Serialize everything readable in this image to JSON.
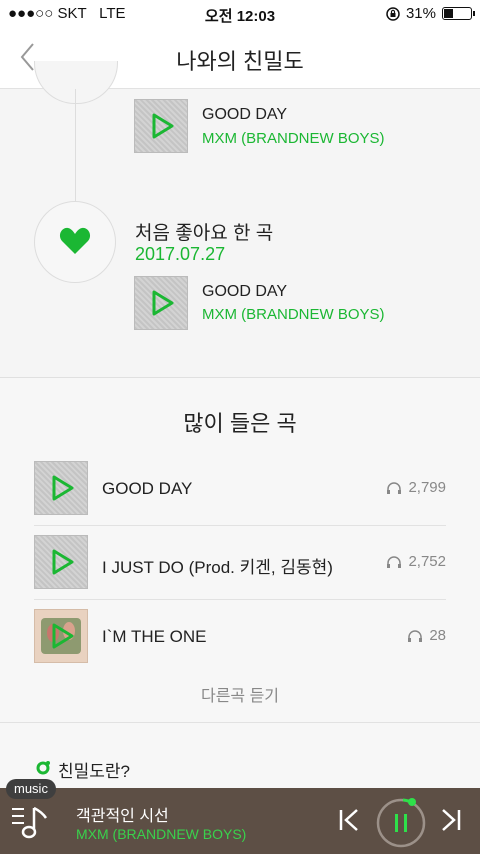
{
  "status": {
    "carrier": "●●●○○ SKT",
    "network": "LTE",
    "time": "오전 12:03",
    "battery": "31%"
  },
  "nav": {
    "title": "나와의 친밀도"
  },
  "timeline": {
    "first_song": {
      "title": "GOOD DAY",
      "artist": "MXM (BRANDNEW BOYS)"
    },
    "event": {
      "title": "처음 좋아요 한 곡",
      "date": "2017.07.27"
    },
    "second_song": {
      "title": "GOOD DAY",
      "artist": "MXM (BRANDNEW BOYS)"
    }
  },
  "most_played": {
    "title": "많이 들은 곡",
    "rows": [
      {
        "name": "GOOD DAY",
        "count": "2,799"
      },
      {
        "name": "I JUST DO (Prod. 키겐, 김동현)",
        "count": "2,752"
      },
      {
        "name": "I`M THE ONE",
        "count": "28"
      }
    ],
    "more_label": "다른곡 듣기"
  },
  "about": {
    "label": "친밀도란?"
  },
  "player": {
    "tag": "music",
    "title": "객관적인 시선",
    "artist": "MXM (BRANDNEW BOYS)"
  },
  "colors": {
    "accent": "#1bb733",
    "player_bg": "#5d4f45"
  },
  "icons": [
    "back-icon",
    "heart-icon",
    "play-icon",
    "headphone-icon",
    "list-icon",
    "note-icon",
    "prev-icon",
    "pause-icon",
    "next-icon"
  ]
}
